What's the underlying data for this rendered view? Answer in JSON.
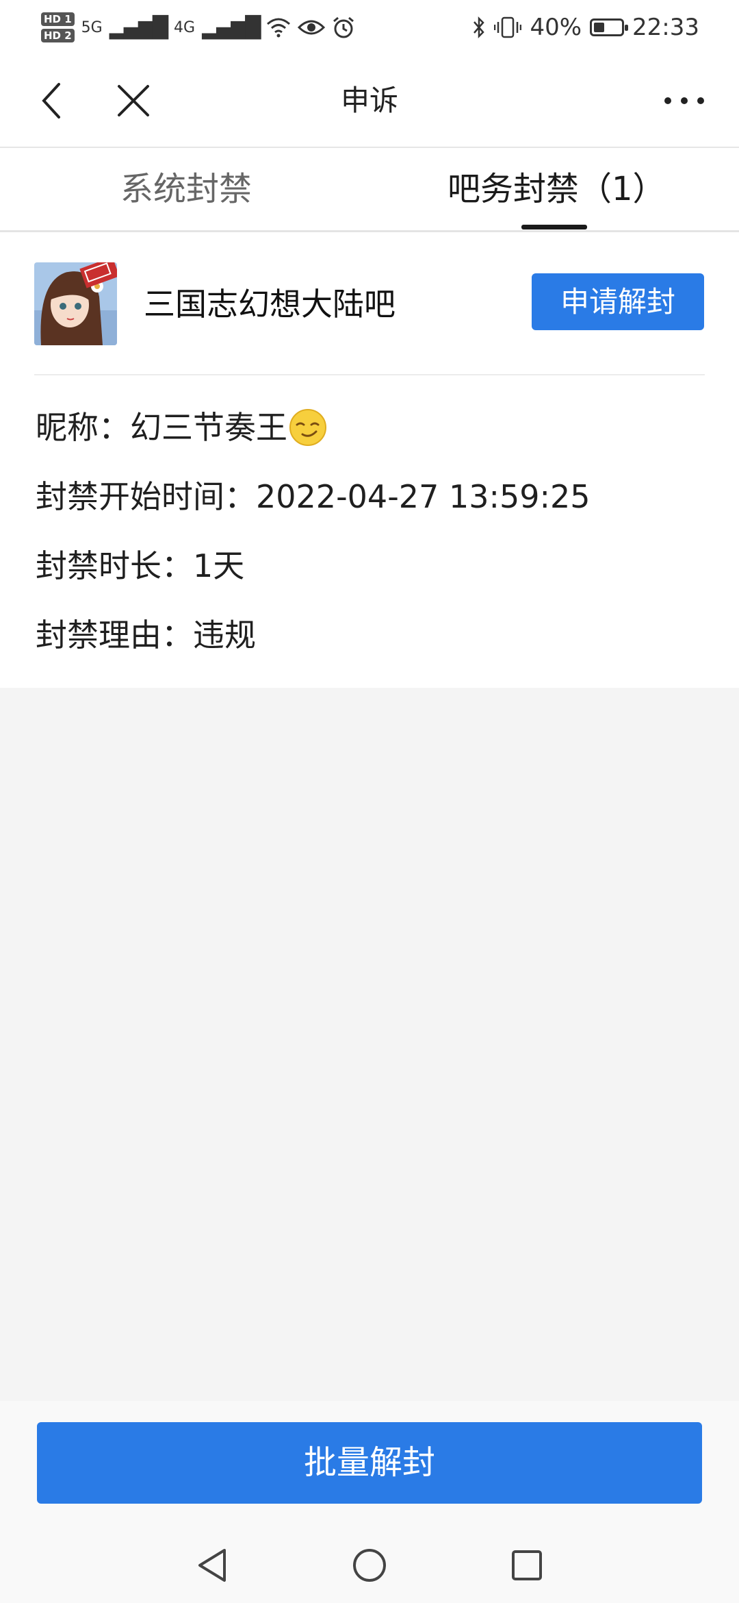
{
  "status_bar": {
    "hd1": "HD 1",
    "hd2": "HD 2",
    "net1": "5G",
    "net2": "4G",
    "battery_percent": "40%",
    "battery_level": 0.4,
    "time": "22:33"
  },
  "title_bar": {
    "title": "申诉",
    "back_icon": "chevron-left-icon",
    "close_icon": "close-icon",
    "more_icon": "more-dots-icon"
  },
  "tabs": [
    {
      "label": "系统封禁",
      "active": false
    },
    {
      "label": "吧务封禁（1）",
      "active": true
    }
  ],
  "ban_record": {
    "forum_name": "三国志幻想大陆吧",
    "unblock_button": "申请解封",
    "nickname_label": "昵称：",
    "nickname_value": "幻三节奏王",
    "start_label": "封禁开始时间：",
    "start_value": "2022-04-27 13:59:25",
    "duration_label": "封禁时长：",
    "duration_value": "1天",
    "reason_label": "封禁理由：",
    "reason_value": "违规"
  },
  "bottom": {
    "batch_button": "批量解封"
  },
  "nav_bar": {
    "icons": [
      "triangle-back-icon",
      "circle-home-icon",
      "square-recent-icon"
    ]
  },
  "colors": {
    "accent": "#2a7be6",
    "background": "#f4f4f4"
  }
}
